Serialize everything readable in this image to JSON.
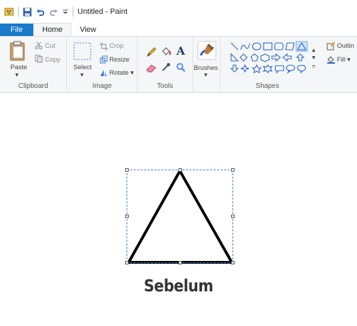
{
  "window": {
    "title": "Untitled - Paint"
  },
  "tabs": [
    {
      "label": "File"
    },
    {
      "label": "Home"
    },
    {
      "label": "View"
    }
  ],
  "clipboard": {
    "paste": "Paste",
    "cut": "Cut",
    "copy": "Copy",
    "group": "Clipboard"
  },
  "image": {
    "select": "Select",
    "crop": "Crop",
    "resize": "Resize",
    "rotate": "Rotate",
    "group": "Image"
  },
  "tools": {
    "group": "Tools",
    "text_glyph": "A"
  },
  "brushes": {
    "label": "Brushes"
  },
  "shapes": {
    "group": "Shapes",
    "outline": "Outlin",
    "fill": "Fill"
  },
  "canvas": {
    "caption": "Sebelum"
  },
  "colors": {
    "file_tab": "#1979ca",
    "ribbon_bg": "#f5f6f7",
    "selection": "#3b7ddd",
    "shape_stroke": "#000000"
  }
}
